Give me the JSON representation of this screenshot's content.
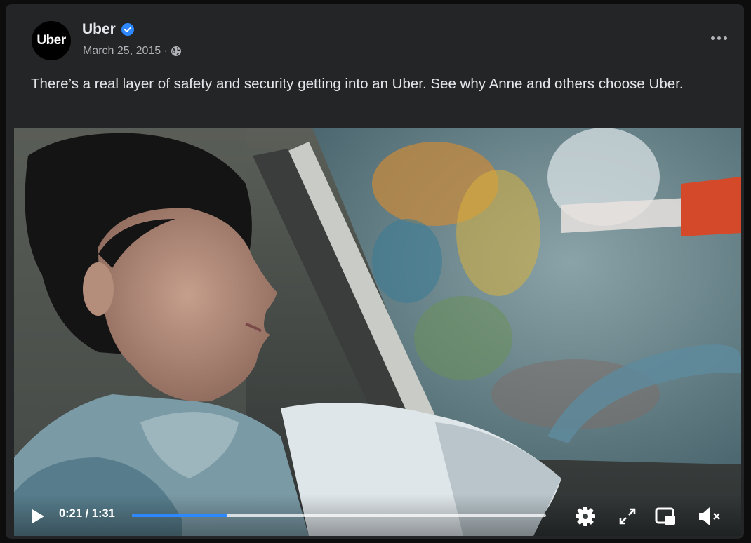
{
  "post": {
    "page_name": "Uber",
    "avatar_text": "Uber",
    "verified": true,
    "date": "March 25, 2015",
    "meta_separator": "·",
    "audience_icon": "globe-icon",
    "text": "There’s a real layer of safety and security getting into an Uber. See why Anne and others choose Uber."
  },
  "video": {
    "time_label": "0:21 / 1:31",
    "progress_fraction": 0.23,
    "icons": [
      "play-icon",
      "settings-gear-icon",
      "fullscreen-icon",
      "picture-in-picture-icon",
      "muted-speaker-icon"
    ]
  },
  "colors": {
    "card_background": "#242526",
    "primary_text": "#e4e6eb",
    "secondary_text": "#b0b3b8",
    "verified_badge": "#2d88ff",
    "progress_fill": "#2d88ff"
  }
}
